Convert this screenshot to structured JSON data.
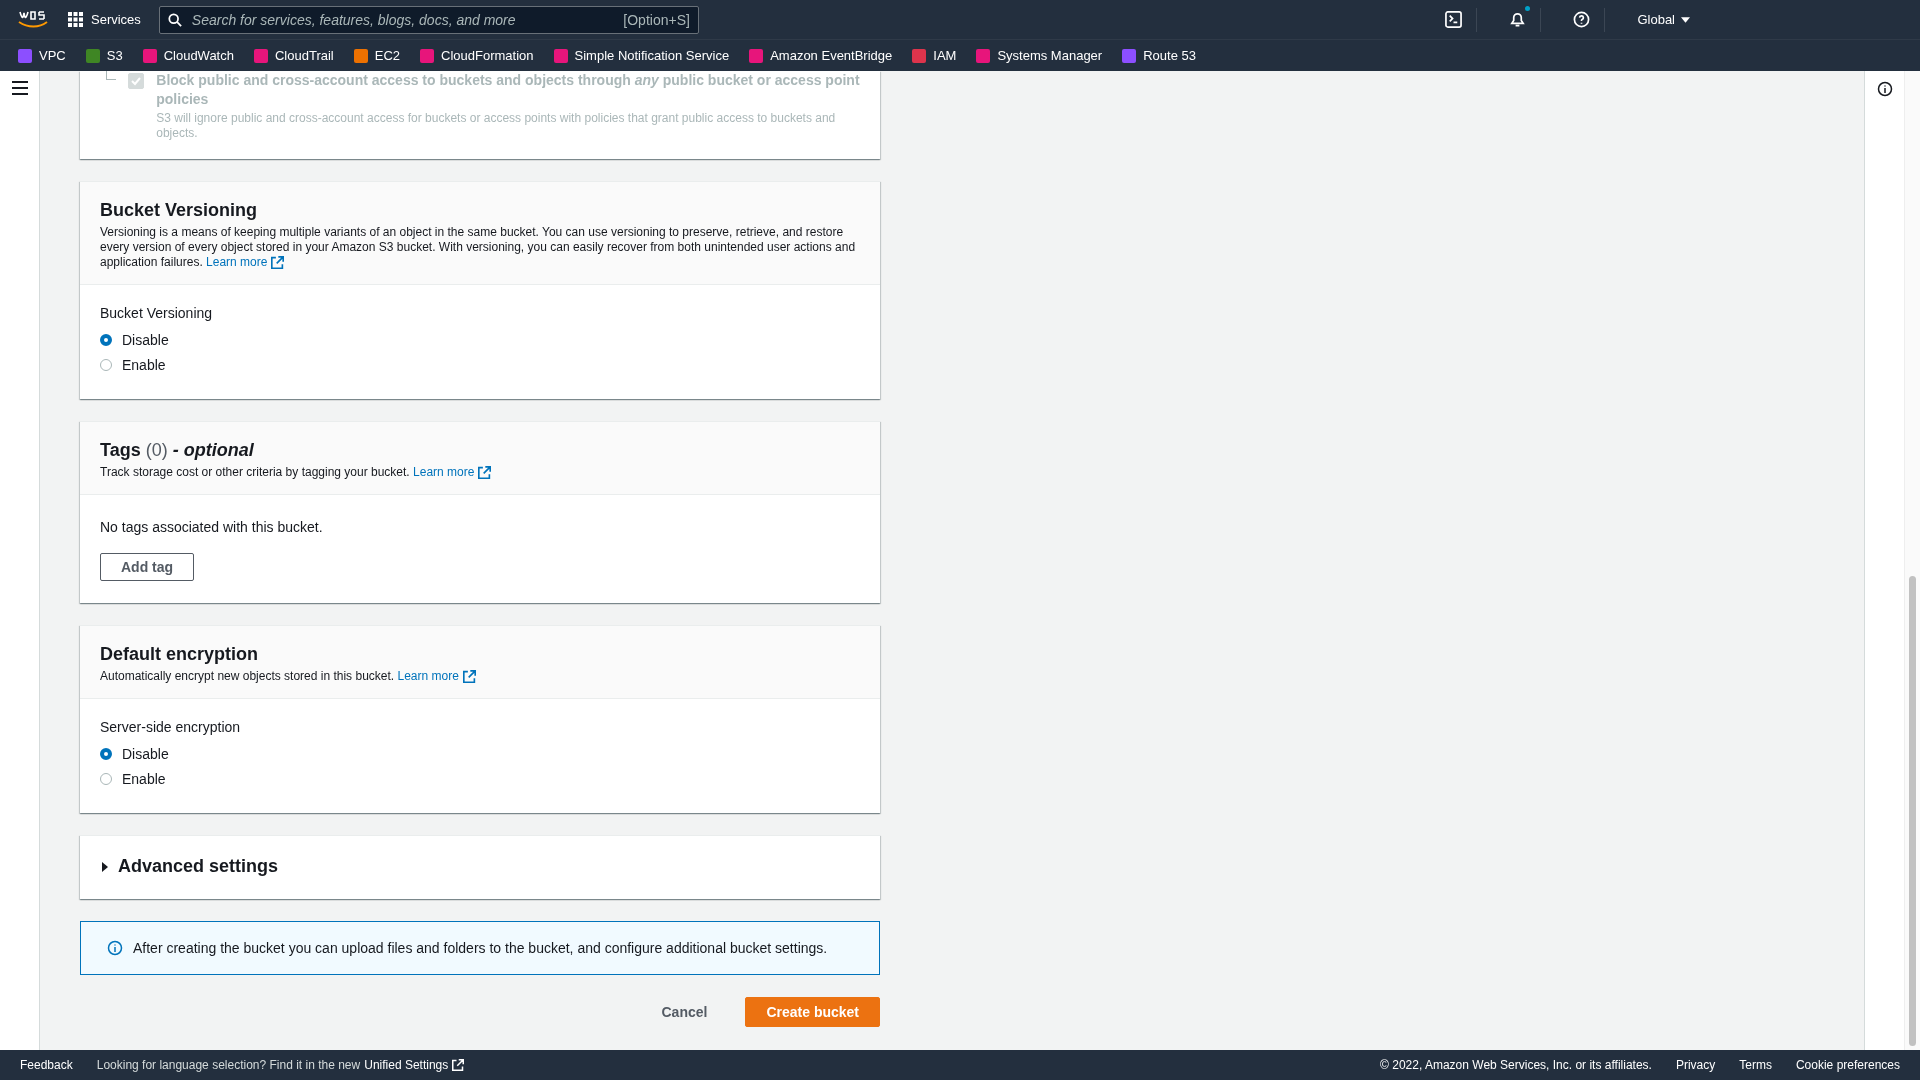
{
  "top_nav": {
    "services": "Services",
    "search": {
      "placeholder": "Search for services, features, blogs, docs, and more",
      "shortcut": "[Option+S]"
    },
    "notification_dot": true,
    "region": "Global"
  },
  "favorites": [
    {
      "label": "VPC",
      "color": "#8c4fff"
    },
    {
      "label": "S3",
      "color": "#3f8624"
    },
    {
      "label": "CloudWatch",
      "color": "#e7157b"
    },
    {
      "label": "CloudTrail",
      "color": "#e7157b"
    },
    {
      "label": "EC2",
      "color": "#ed7100"
    },
    {
      "label": "CloudFormation",
      "color": "#e7157b"
    },
    {
      "label": "Simple Notification Service",
      "color": "#e7157b"
    },
    {
      "label": "Amazon EventBridge",
      "color": "#e7157b"
    },
    {
      "label": "IAM",
      "color": "#dd344c"
    },
    {
      "label": "Systems Manager",
      "color": "#e7157b"
    },
    {
      "label": "Route 53",
      "color": "#8c4fff"
    }
  ],
  "sections": [
    {
      "kind": "checkbox_panel",
      "option": {
        "label": "Block public and cross-account access to buckets and objects through *any* public bucket or access point policies",
        "description": "S3 will ignore public and cross-account access for buckets or access points with policies that grant public access to buckets and objects.",
        "checked": true,
        "disabled": true
      }
    },
    {
      "kind": "radio_panel",
      "title": "Bucket Versioning",
      "description": "Versioning is a means of keeping multiple variants of an object in the same bucket. You can use versioning to preserve, retrieve, and restore every version of every object stored in your Amazon S3 bucket. With versioning, you can easily recover from both unintended user actions and application failures.",
      "link": "Learn more",
      "field_label": "Bucket Versioning",
      "options": [
        {
          "label": "Disable",
          "selected": true
        },
        {
          "label": "Enable",
          "selected": false
        }
      ]
    },
    {
      "kind": "tags_panel",
      "title": "Tags",
      "count": "(0)",
      "suffix": "- optional",
      "description": "Track storage cost or other criteria by tagging your bucket.",
      "link": "Learn more",
      "empty": "No tags associated with this bucket.",
      "button": "Add tag"
    },
    {
      "kind": "radio_panel",
      "title": "Default encryption",
      "description": "Automatically encrypt new objects stored in this bucket.",
      "link": "Learn more",
      "field_label": "Server-side encryption",
      "options": [
        {
          "label": "Disable",
          "selected": true
        },
        {
          "label": "Enable",
          "selected": false
        }
      ]
    },
    {
      "kind": "expander",
      "title": "Advanced settings",
      "expanded": false
    },
    {
      "kind": "info",
      "text": "After creating the bucket you can upload files and folders to the bucket, and configure additional bucket settings."
    }
  ],
  "actions": {
    "cancel": "Cancel",
    "submit": "Create bucket"
  },
  "footer": {
    "feedback": "Feedback",
    "language_note": "Looking for language selection? Find it in the new",
    "settings_link": "Unified Settings",
    "copyright": "© 2022, Amazon Web Services, Inc. or its affiliates.",
    "links": [
      "Privacy",
      "Terms",
      "Cookie preferences"
    ]
  }
}
